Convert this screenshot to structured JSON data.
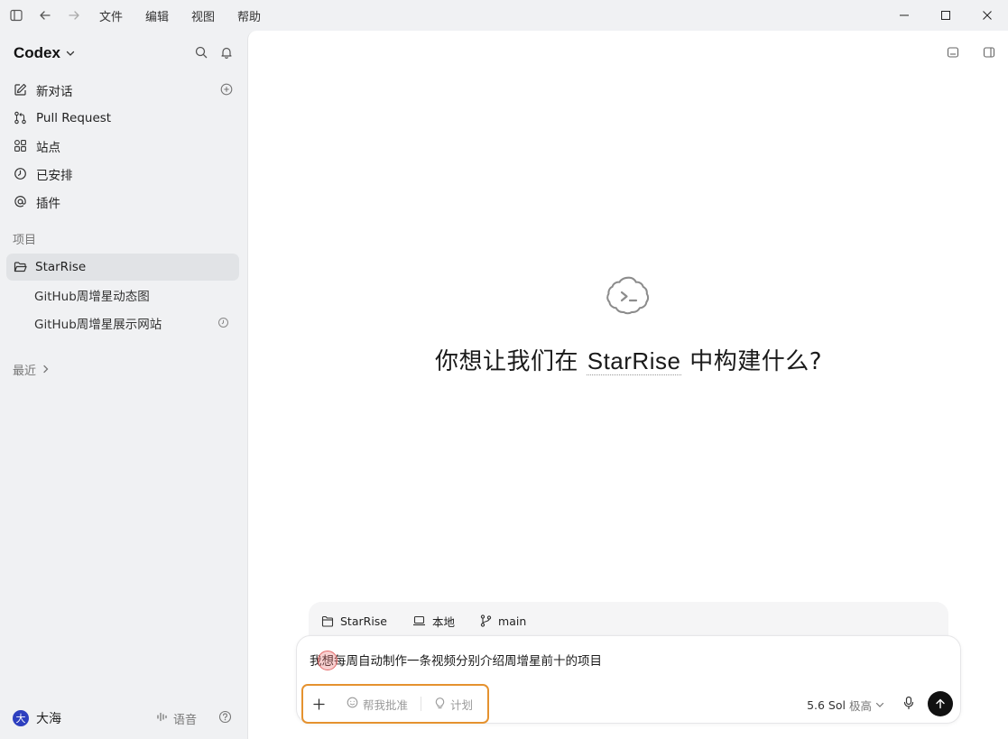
{
  "menu": [
    "文件",
    "编辑",
    "视图",
    "帮助"
  ],
  "sidebar": {
    "brand": "Codex",
    "nav": [
      {
        "label": "新对话",
        "icon": "edit-icon"
      },
      {
        "label": "Pull Request",
        "icon": "git-pull-icon"
      },
      {
        "label": "站点",
        "icon": "grid-icon"
      },
      {
        "label": "已安排",
        "icon": "clock-icon"
      },
      {
        "label": "插件",
        "icon": "at-icon"
      }
    ],
    "projects_label": "项目",
    "project": "StarRise",
    "threads": [
      "GitHub周增星动态图",
      "GitHub周增星展示网站"
    ],
    "recent_label": "最近",
    "user": {
      "initial": "大",
      "name": "大海"
    },
    "voice_label": "语音"
  },
  "main": {
    "hero_before": "你想让我们在 ",
    "hero_project": "StarRise",
    "hero_after": " 中构建什么?",
    "context": {
      "project": "StarRise",
      "env": "本地",
      "branch": "main"
    },
    "composer": {
      "text": "我想每周自动制作一条视频分别介绍周增星前十的项目",
      "pill_approve": "帮我批准",
      "pill_plan": "计划",
      "model": "5.6 Sol",
      "level": "极高"
    }
  },
  "colors": {
    "accent_outline": "#e5922f",
    "avatar": "#2d3fbf",
    "sidebar_bg": "#f0f1f3"
  }
}
